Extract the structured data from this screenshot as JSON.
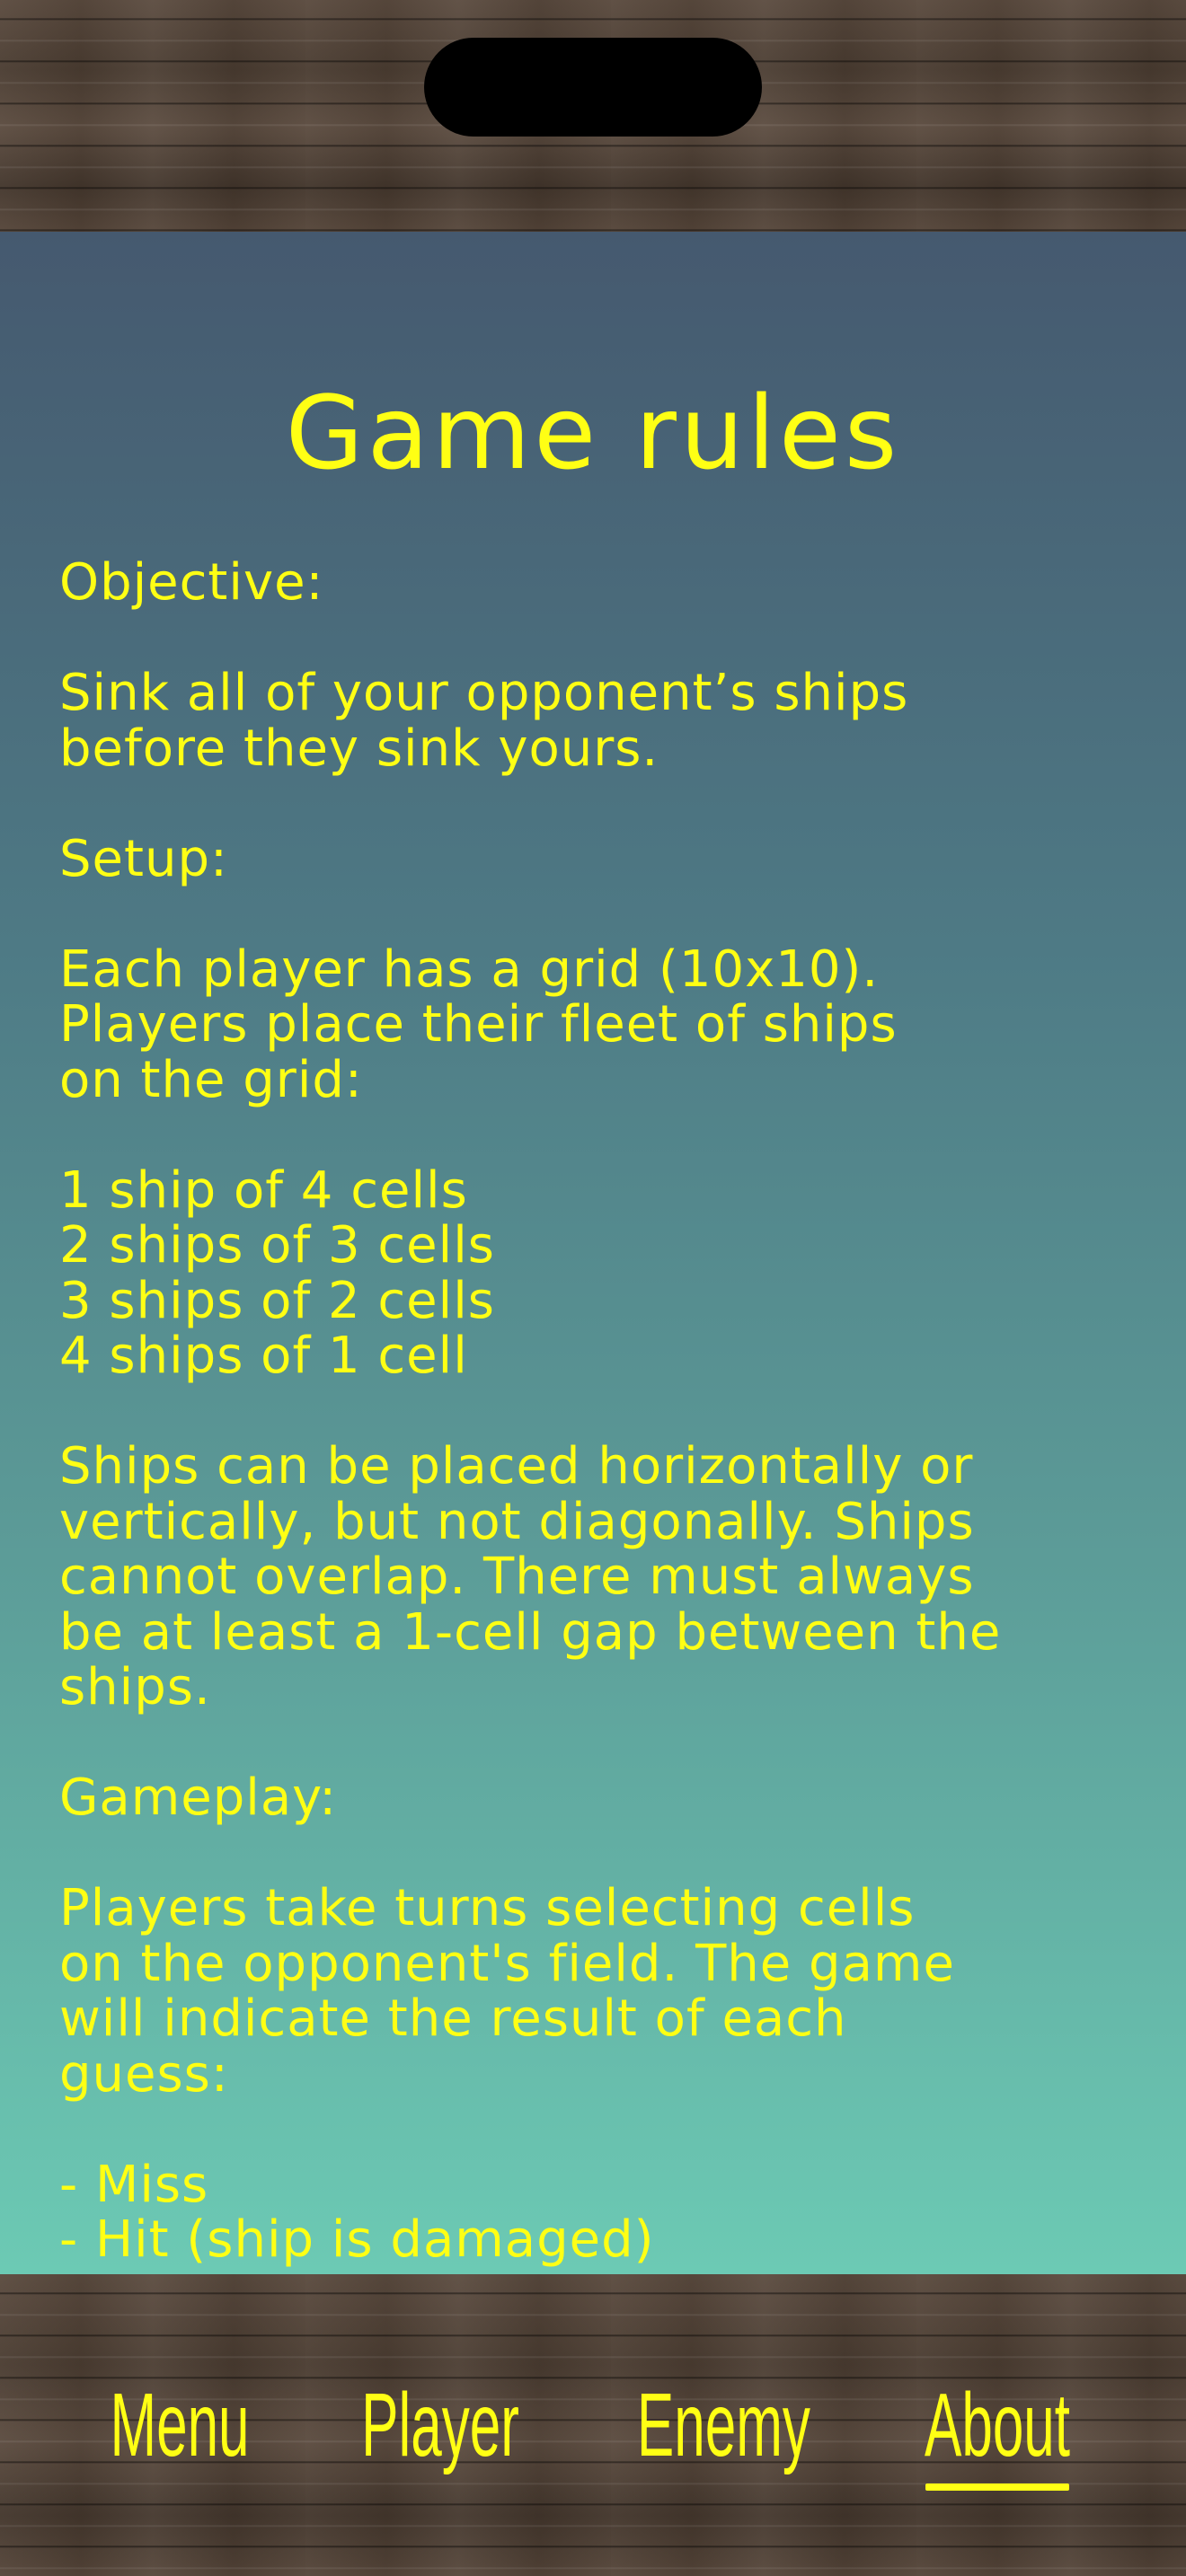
{
  "screen": {
    "title": "Game rules",
    "rules_text": "Objective:\n\nSink all of your opponent’s ships\nbefore they sink yours.\n\nSetup:\n\nEach player has a grid (10x10).\nPlayers place their fleet of ships\non the grid:\n\n1 ship of 4 cells\n2 ships of 3 cells\n3 ships of 2 cells\n4 ships of 1 cell\n\nShips can be placed horizontally or\nvertically, but not diagonally. Ships\ncannot overlap. There must always\nbe at least a 1-cell gap between the\nships.\n\nGameplay:\n\nPlayers take turns selecting cells\non the opponent's field. The game\nwill indicate the result of each\nguess:\n\n- Miss\n- Hit (ship is damaged)"
  },
  "tabs": [
    {
      "label": "Menu"
    },
    {
      "label": "Player"
    },
    {
      "label": "Enemy"
    },
    {
      "label": "About"
    }
  ],
  "selected_tab": "About",
  "colors": {
    "text_accent": "#ffff14",
    "gradient_top": "#45596f",
    "gradient_bottom": "#6ccab4",
    "wood": "#4a3c31"
  }
}
